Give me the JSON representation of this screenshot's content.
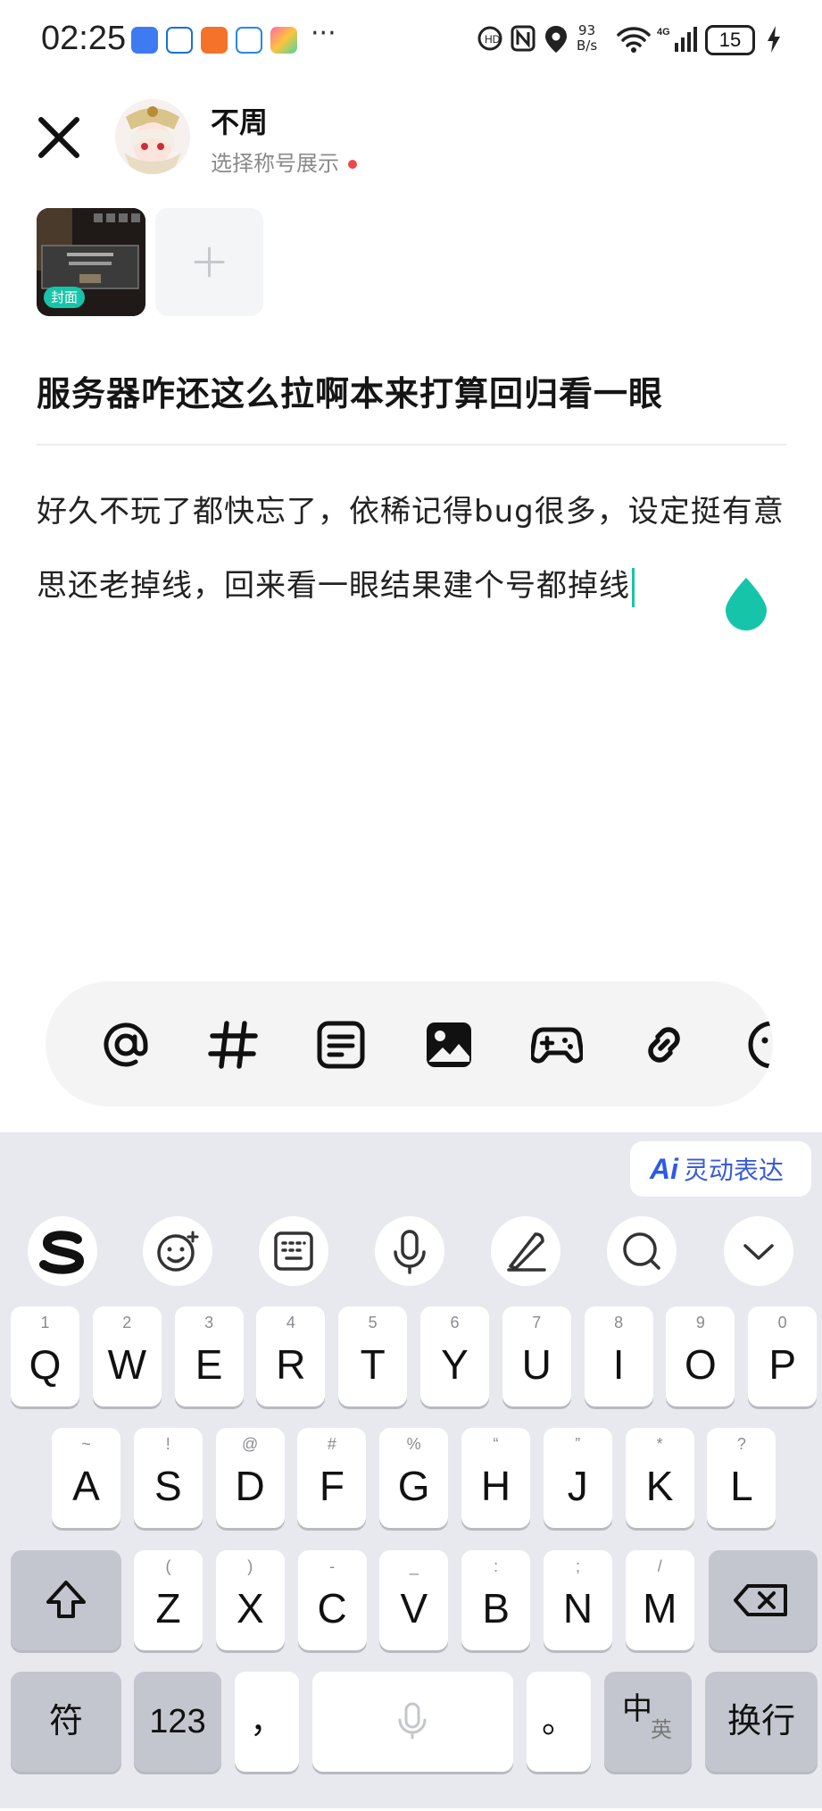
{
  "status_bar": {
    "time": "02:25",
    "more": "···",
    "net_speed_value": "93",
    "net_speed_unit": "B/s",
    "battery": "15"
  },
  "header": {
    "username": "不周",
    "subtitle": "选择称号展示"
  },
  "media": {
    "cover_label": "封面",
    "add_label": "+"
  },
  "post": {
    "title": "服务器咋还这么拉啊本来打算回归看一眼",
    "body": "好久不玩了都快忘了，依稀记得bug很多，设定挺有意思还老掉线，回来看一眼结果建个号都掉线"
  },
  "toolbar": {
    "icons": [
      "at-icon",
      "hashtag-icon",
      "document-icon",
      "image-icon",
      "gamepad-icon",
      "link-icon",
      "emoji-icon"
    ]
  },
  "keyboard": {
    "ai_label": "灵动表达",
    "ai_mark": "Ai",
    "row1": [
      {
        "key": "Q",
        "hint": "1"
      },
      {
        "key": "W",
        "hint": "2"
      },
      {
        "key": "E",
        "hint": "3"
      },
      {
        "key": "R",
        "hint": "4"
      },
      {
        "key": "T",
        "hint": "5"
      },
      {
        "key": "Y",
        "hint": "6"
      },
      {
        "key": "U",
        "hint": "7"
      },
      {
        "key": "I",
        "hint": "8"
      },
      {
        "key": "O",
        "hint": "9"
      },
      {
        "key": "P",
        "hint": "0"
      }
    ],
    "row2": [
      {
        "key": "A",
        "hint": "~"
      },
      {
        "key": "S",
        "hint": "!"
      },
      {
        "key": "D",
        "hint": "@"
      },
      {
        "key": "F",
        "hint": "#"
      },
      {
        "key": "G",
        "hint": "%"
      },
      {
        "key": "H",
        "hint": "“"
      },
      {
        "key": "J",
        "hint": "”"
      },
      {
        "key": "K",
        "hint": "*"
      },
      {
        "key": "L",
        "hint": "?"
      }
    ],
    "row3": [
      {
        "key": "Z",
        "hint": "("
      },
      {
        "key": "X",
        "hint": ")"
      },
      {
        "key": "C",
        "hint": "-"
      },
      {
        "key": "V",
        "hint": "_"
      },
      {
        "key": "B",
        "hint": ":"
      },
      {
        "key": "N",
        "hint": ";"
      },
      {
        "key": "M",
        "hint": "/"
      }
    ],
    "symbol_key": "符",
    "number_key": "123",
    "comma_key": "，",
    "period_key": "。",
    "lang_key_main": "中",
    "lang_key_sub": "英",
    "enter_key": "换行"
  },
  "colors": {
    "accent": "#16c5a9",
    "badge_red": "#f0444d",
    "keyboard_bg": "#e8e9ee"
  }
}
